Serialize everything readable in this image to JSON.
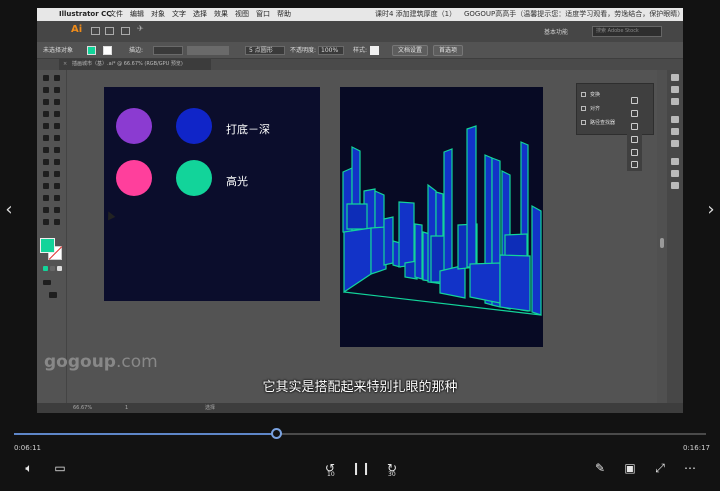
{
  "player": {
    "elapsed": "0:06:11",
    "total": "0:16:17",
    "progress": 0.38,
    "skip_back_label": "10",
    "skip_forward_label": "30"
  },
  "mac_menu": {
    "app_name": "Illustrator CC",
    "items": [
      "文件",
      "编辑",
      "对象",
      "文字",
      "选择",
      "效果",
      "视图",
      "窗口",
      "帮助"
    ],
    "center_title": "课时4 添加建筑厚度（1）",
    "right_text": "GOGOUP高高手（温馨提示您：适度学习观看，劳逸结合，保护眼睛）"
  },
  "illustrator": {
    "logo": "Ai",
    "workspace_label": "基本功能",
    "search_placeholder": "搜索 Adobe Stock",
    "control": {
      "no_selection": "未选择对象",
      "stroke_label": "描边:",
      "brush_label": "5 点圆形",
      "opacity_label": "不透明度:",
      "opacity_value": "100%",
      "style_label": "样式:",
      "doc_setup": "文档设置",
      "preferences": "首选项"
    },
    "doc_tab": "插画城市（基）.ai* @ 66.67% (RGB/GPU 预览)",
    "panel": {
      "items": [
        "变换",
        "对齐",
        "路径查找器"
      ]
    },
    "status": {
      "zoom": "66.67%",
      "page": "1",
      "tool": "选择"
    }
  },
  "artboard1": {
    "label_dark": "打底－深",
    "label_light": "高光",
    "colors": {
      "purple": "#8b3bd1",
      "blue": "#1025c8",
      "pink": "#ff3f9c",
      "teal": "#12d49a"
    }
  },
  "colors": {
    "fill_swatch": "#12d49a",
    "artboard_bg": "#0b0d2c",
    "building_fill": "#1233c8",
    "building_stroke": "#12d49a"
  },
  "watermark": {
    "brand": "gogoup",
    "domain": ".com"
  },
  "subtitle": "它其实是搭配起来特别扎眼的那种"
}
